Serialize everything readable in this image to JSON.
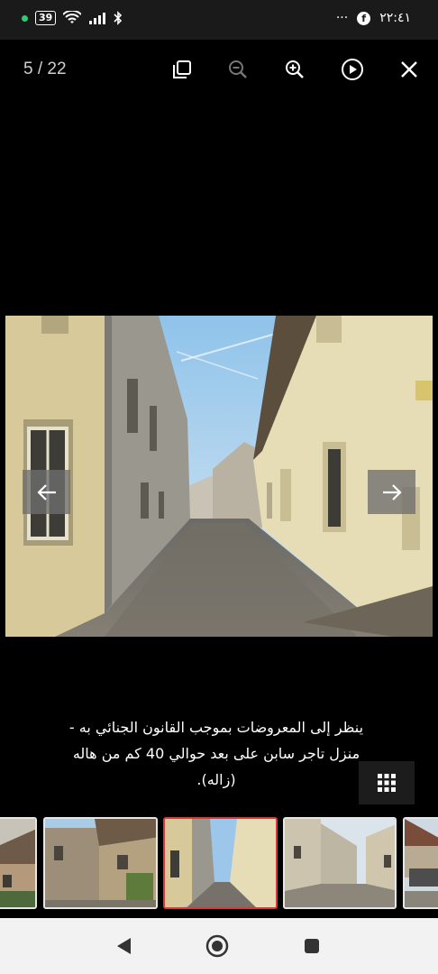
{
  "status_bar": {
    "battery": "39",
    "time": "٢٢:٤١",
    "more": "···",
    "fb": "f"
  },
  "viewer": {
    "counter": "5 / 22",
    "icons": [
      "copy-icon",
      "zoom-out-icon",
      "zoom-in-icon",
      "play-icon",
      "close-icon"
    ],
    "caption_line1": "ينظر إلى المعروضات بموجب القانون الجنائي به -",
    "caption_line2": "منزل تاجر سابن على بعد حوالي 40 كم من هاله",
    "caption_line3": "(زاله)."
  },
  "thumbnails": {
    "count_visible": 6,
    "active_index": 2
  },
  "colors": {
    "active_thumb_border": "#d63a3a",
    "thumb_border": "#e6e6e6",
    "status_dot": "#2ecc71"
  }
}
